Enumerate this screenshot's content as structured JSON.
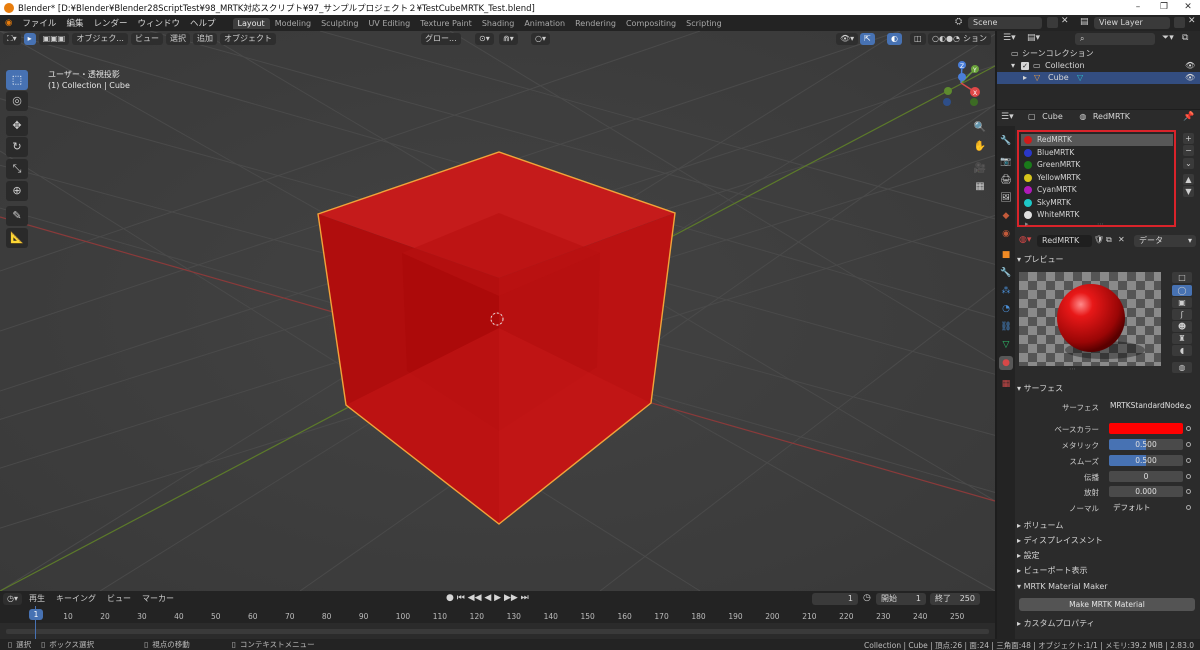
{
  "window": {
    "title": "Blender* [D:¥Blender¥Blender28ScriptTest¥98_MRTK対応スクリプト¥97_サンプルプロジェクト２¥TestCubeMRTK_Test.blend]",
    "minimize": "–",
    "maximize": "❐",
    "close": "✕"
  },
  "menu": {
    "items": [
      "ファイル",
      "編集",
      "レンダー",
      "ウィンドウ",
      "ヘルプ"
    ],
    "workspaces": [
      "Layout",
      "Modeling",
      "Sculpting",
      "UV Editing",
      "Texture Paint",
      "Shading",
      "Animation",
      "Rendering",
      "Compositing",
      "Scripting"
    ],
    "active_workspace": "Layout",
    "scene": "Scene",
    "view_layer": "View Layer"
  },
  "viewport": {
    "mode": "オブジェク...",
    "menus": [
      "ビュー",
      "選択",
      "追加",
      "オブジェクト"
    ],
    "transform_orientation": "グロー...",
    "options": "オプション",
    "overlay_title": "ユーザー・透視投影",
    "overlay_subtitle": "(1) Collection | Cube",
    "gizmo": {
      "x": "X",
      "y": "Y",
      "z": "Z"
    }
  },
  "timeline": {
    "menus": [
      "再生",
      "キーイング",
      "ビュー",
      "マーカー"
    ],
    "current_frame": "1",
    "start_label": "開始",
    "start": "1",
    "end_label": "終了",
    "end": "250",
    "ticks": [
      "1",
      "10",
      "20",
      "30",
      "40",
      "50",
      "60",
      "70",
      "80",
      "90",
      "100",
      "110",
      "120",
      "130",
      "140",
      "150",
      "160",
      "170",
      "180",
      "190",
      "200",
      "210",
      "220",
      "230",
      "240",
      "250"
    ]
  },
  "statusbar": {
    "select": "選択",
    "box_select": "ボックス選択",
    "move_view": "視点の移動",
    "context_menu": "コンテキストメニュー",
    "stats": "Collection | Cube | 頂点:26 | 面:24 | 三角面:48 | オブジェクト:1/1 | メモリ:39.2 MiB | 2.83.0"
  },
  "outliner": {
    "search_placeholder": "",
    "scene_collection": "シーンコレクション",
    "collection": "Collection",
    "object": "Cube"
  },
  "properties": {
    "breadcrumb_object": "Cube",
    "breadcrumb_material": "RedMRTK",
    "materials": [
      {
        "name": "RedMRTK",
        "color": "#d11a1a"
      },
      {
        "name": "BlueMRTK",
        "color": "#2a37c8"
      },
      {
        "name": "GreenMRTK",
        "color": "#1a7a1a"
      },
      {
        "name": "YellowMRTK",
        "color": "#d6c51c"
      },
      {
        "name": "CyanMRTK",
        "color": "#b01ab8"
      },
      {
        "name": "SkyMRTK",
        "color": "#1ec8c8"
      },
      {
        "name": "WhiteMRTK",
        "color": "#e0e0e0"
      }
    ],
    "material_field": "RedMRTK",
    "link": "データ",
    "preview_label": "プレビュー",
    "surface_label": "サーフェス",
    "surface_row_label": "サーフェス",
    "surface_value": "MRTKStandardNode...",
    "base_color_label": "ベースカラー",
    "base_color": "#ff0000",
    "metallic_label": "メタリック",
    "metallic": "0.500",
    "metallic_fraction": 0.5,
    "smoothness_label": "スムーズ",
    "smoothness": "0.500",
    "smoothness_fraction": 0.5,
    "transmission_label": "伝播",
    "transmission": "0",
    "emission_label": "放射",
    "emission": "0.000",
    "normal_label": "ノーマル",
    "normal": "デフォルト",
    "volume_label": "ボリューム",
    "displacement_label": "ディスプレイスメント",
    "settings_label": "設定",
    "viewport_display_label": "ビューポート表示",
    "mrtk_panel_label": "MRTK Material Maker",
    "make_button": "Make MRTK Material",
    "custom_props_label": "カスタムプロパティ"
  }
}
